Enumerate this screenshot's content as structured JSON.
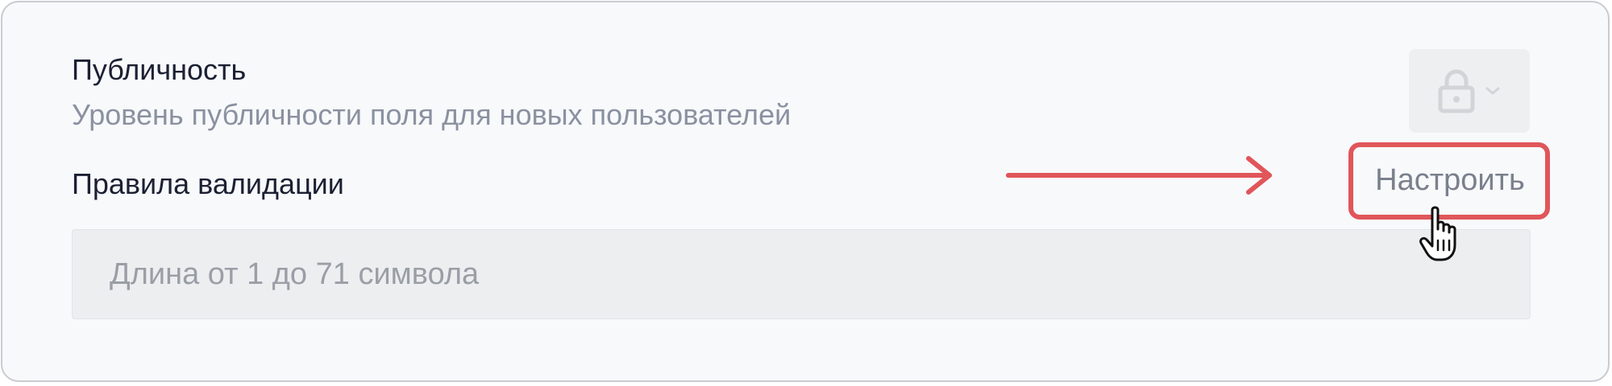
{
  "publicity": {
    "title": "Публичность",
    "description": "Уровень публичности поля для новых пользователей",
    "select_icon": "lock-icon",
    "dropdown_icon": "chevron-down-icon"
  },
  "validation": {
    "label": "Правила валидации",
    "configure_label": "Настроить",
    "rule_text": "Длина от 1 до 71 символа"
  },
  "annotations": {
    "highlight_color": "#e0565a",
    "arrow_icon": "arrow-right-icon",
    "cursor_icon": "hand-pointer-icon"
  }
}
